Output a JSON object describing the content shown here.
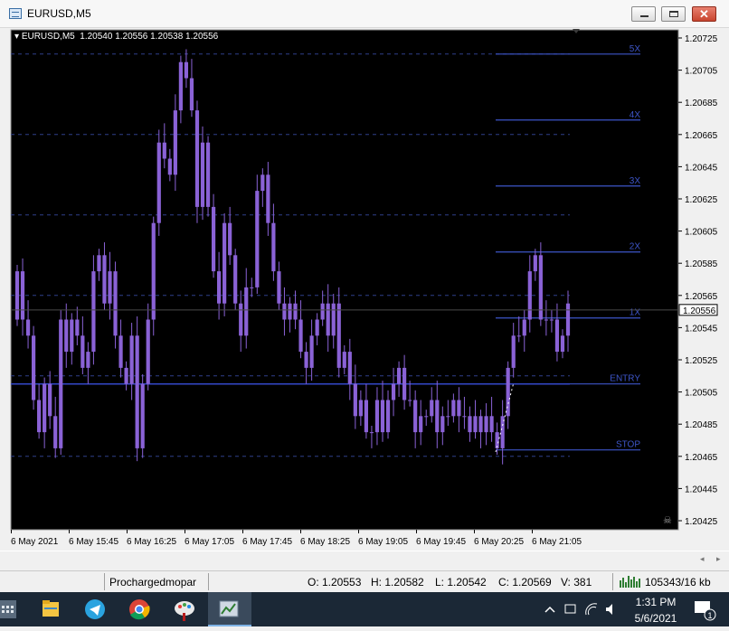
{
  "window": {
    "title": "EURUSD,M5"
  },
  "chart": {
    "symbol_info": "EURUSD,M5  1.20540 1.20556 1.20538 1.20556",
    "current_price": "1.20556",
    "price_axis": [
      "1.20725",
      "1.20705",
      "1.20685",
      "1.20665",
      "1.20645",
      "1.20625",
      "1.20605",
      "1.20585",
      "1.20565",
      "1.20545",
      "1.20525",
      "1.20505",
      "1.20485",
      "1.20465",
      "1.20445",
      "1.20425"
    ],
    "time_axis": [
      "6 May 2021",
      "6 May 15:45",
      "6 May 16:25",
      "6 May 17:05",
      "6 May 17:45",
      "6 May 18:25",
      "6 May 19:05",
      "6 May 19:45",
      "6 May 20:25",
      "6 May 21:05"
    ],
    "level_labels": {
      "x5": "5X",
      "x4": "4X",
      "x3": "3X",
      "x2": "2X",
      "x1": "1X",
      "entry": "ENTRY",
      "stop": "STOP"
    },
    "colors": {
      "background": "#000000",
      "candle": "#8a62d6",
      "grid": "#2f3f8a",
      "level": "#3d55c8",
      "text": "#ffffff"
    }
  },
  "chart_data": {
    "type": "candlestick",
    "title": "EURUSD,M5",
    "ylim": [
      1.2042,
      1.2073
    ],
    "ohlc_header": {
      "open": 1.2054,
      "high": 1.20556,
      "low": 1.20538,
      "close": 1.20556
    },
    "levels": [
      {
        "label": "5X",
        "price": 1.20715
      },
      {
        "label": "4X",
        "price": 1.20674
      },
      {
        "label": "3X",
        "price": 1.20633
      },
      {
        "label": "2X",
        "price": 1.20592
      },
      {
        "label": "1X",
        "price": 1.20551
      },
      {
        "label": "ENTRY",
        "price": 1.2051
      },
      {
        "label": "STOP",
        "price": 1.20469
      }
    ],
    "entry_line": 1.2051
  },
  "status": {
    "profile": "Prochargedmopar",
    "open": "O: 1.20553",
    "high": "H: 1.20582",
    "low": "L: 1.20542",
    "close": "C: 1.20569",
    "volume": "V: 381",
    "traffic": "105343/16 kb"
  },
  "scroll": {
    "left": "◂",
    "right": "▸"
  },
  "taskbar": {
    "apps": [
      "calculator-icon",
      "file-explorer-icon",
      "telegram-icon",
      "chrome-icon",
      "paint-icon",
      "metatrader-icon"
    ],
    "time": "1:31 PM",
    "date": "5/6/2021",
    "notification_count": "1"
  }
}
